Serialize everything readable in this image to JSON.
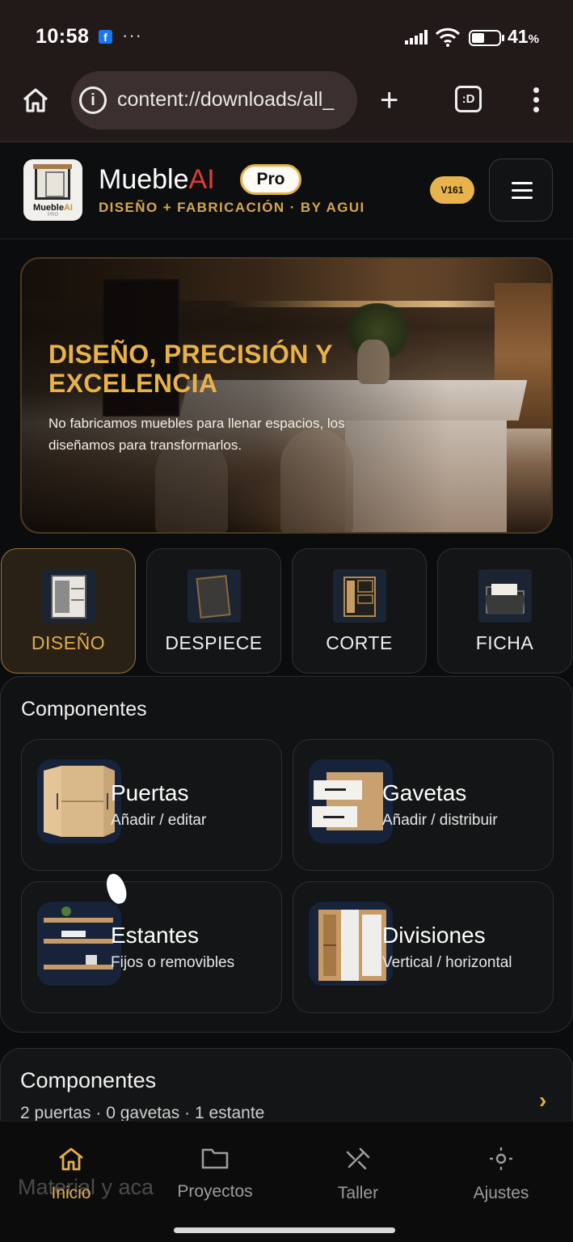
{
  "status": {
    "time": "10:58",
    "fb": "f",
    "dots": "···",
    "battery_pct": "41",
    "battery_unit": "%"
  },
  "browser": {
    "url": "content://downloads/all_",
    "tabs_label": ":D",
    "plus": "+"
  },
  "app": {
    "logo_name": "Mueble",
    "logo_ai": "AI",
    "logo_pro": "PRO",
    "brand_name": "Mueble",
    "brand_ai": "AI",
    "pro_badge": "Pro",
    "tagline": "DISEÑO + FABRICACIÓN · BY AGUI",
    "version": "V161"
  },
  "hero": {
    "title": "DISEÑO, PRECISIÓN Y EXCELENCIA",
    "text": "No fabricamos muebles para llenar espacios, los diseñamos para transformarlos."
  },
  "modes": [
    {
      "label": "DISEÑO",
      "icon": "cabinet-icon"
    },
    {
      "label": "DESPIECE",
      "icon": "board-icon"
    },
    {
      "label": "CORTE",
      "icon": "cut-panel-icon"
    },
    {
      "label": "FICHA",
      "icon": "folder-icon"
    }
  ],
  "components": {
    "title": "Componentes",
    "cards": [
      {
        "title": "Puertas",
        "subtitle": "Añadir / editar",
        "icon": "doors-icon"
      },
      {
        "title": "Gavetas",
        "subtitle": "Añadir / distribuir",
        "icon": "drawers-icon"
      },
      {
        "title": "Estantes",
        "subtitle": "Fijos o removibles",
        "icon": "shelves-icon"
      },
      {
        "title": "Divisiones",
        "subtitle": "Vertical / horizontal",
        "icon": "dividers-icon"
      }
    ]
  },
  "summary": {
    "title": "Componentes",
    "detail": "2 puertas · 0 gavetas · 1 estante",
    "chevron": "›",
    "next_section_partial": "Material y aca"
  },
  "nav": [
    {
      "label": "Inicio",
      "icon": "home-icon"
    },
    {
      "label": "Proyectos",
      "icon": "folder-icon"
    },
    {
      "label": "Taller",
      "icon": "tools-icon"
    },
    {
      "label": "Ajustes",
      "icon": "settings-icon"
    }
  ],
  "colors": {
    "accent": "#e3ac4c",
    "brand_ai": "#e23b3b",
    "background": "#0b0c0d"
  }
}
